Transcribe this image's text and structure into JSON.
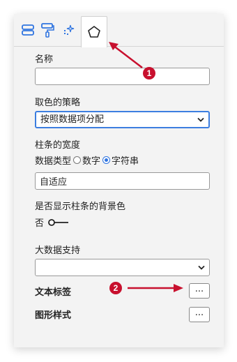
{
  "tabs": [
    {
      "icon": "layout-rows-icon"
    },
    {
      "icon": "paint-roller-icon"
    },
    {
      "icon": "sparkles-icon"
    },
    {
      "icon": "pentagon-icon"
    }
  ],
  "fields": {
    "name_label": "名称",
    "name_value": "",
    "color_strategy_label": "取色的策略",
    "color_strategy_value": "按照数据项分配",
    "bar_width_label": "柱条的宽度",
    "data_type_label": "数据类型",
    "data_type_options": [
      "数字",
      "字符串"
    ],
    "data_type_selected": "字符串",
    "bar_width_value": "自适应",
    "show_bg_label": "是否显示柱条的背景色",
    "show_bg_value": "否",
    "big_data_label": "大数据支持",
    "big_data_value": "",
    "text_label_label": "文本标签",
    "shape_style_label": "图形样式",
    "dots": "..."
  },
  "annotations": [
    {
      "number": "1"
    },
    {
      "number": "2"
    }
  ],
  "colors": {
    "accent": "#2f74e0",
    "annotation": "#c8102e"
  }
}
